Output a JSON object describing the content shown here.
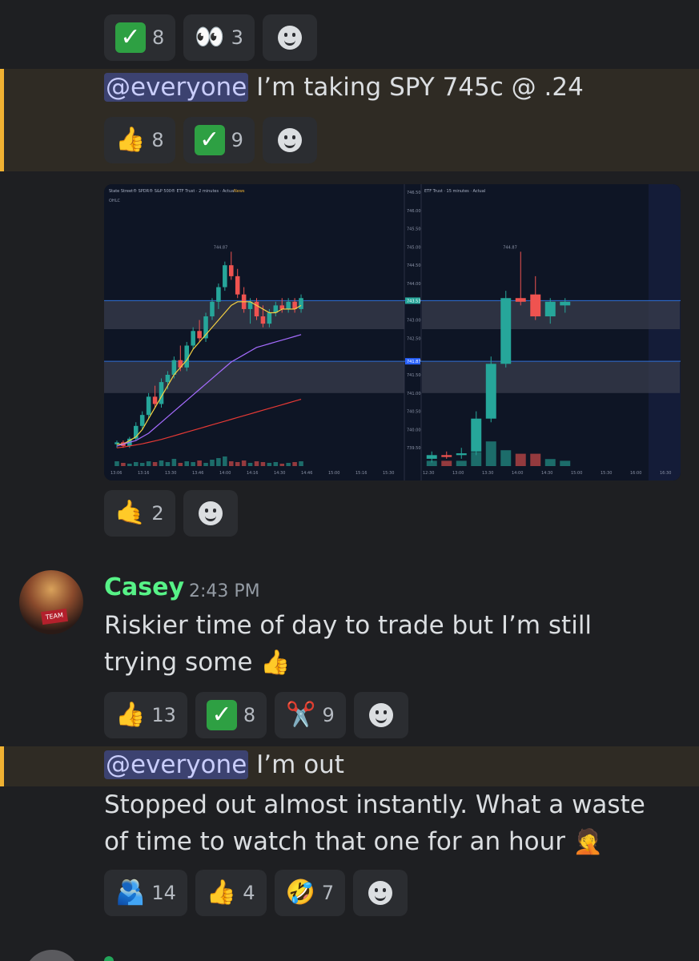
{
  "messages": {
    "top_reactions": [
      {
        "emoji": "check-mark",
        "count": "8"
      },
      {
        "emoji": "eyes",
        "count": "3"
      }
    ],
    "entry_message": {
      "mention": "@everyone",
      "text": "I’m taking SPY 745c @ .24",
      "reactions": [
        {
          "emoji": "👍",
          "count": "8"
        },
        {
          "emoji": "check-mark",
          "count": "9"
        }
      ]
    },
    "chart_reactions": [
      {
        "emoji": "🤙",
        "count": "2"
      }
    ],
    "casey_post": {
      "username": "Casey",
      "timestamp": "2:43 PM",
      "text": "Riskier time of day to trade but I’m still trying some",
      "reactions": [
        {
          "emoji": "👍",
          "count": "13"
        },
        {
          "emoji": "check-mark",
          "count": "8"
        },
        {
          "emoji": "✂️",
          "count": "9"
        }
      ]
    },
    "exit_message": {
      "mention": "@everyone",
      "text": "I’m out",
      "followup": "Stopped out almost instantly. What a waste of time to watch that one for an hour",
      "reactions": [
        {
          "emoji": "🫂",
          "count": "14"
        },
        {
          "emoji": "👍",
          "count": "4"
        },
        {
          "emoji": "🤣",
          "count": "7"
        }
      ]
    }
  },
  "chart_data": [
    {
      "type": "candlestick",
      "title": "State Street® SPDR® S&P 500® ETF Trust · 2 minutes · Actual",
      "news_label": "News",
      "indicator_label": "OHLC",
      "ylim": [
        739.0,
        746.5
      ],
      "y_ticks": [
        "746.50",
        "746.00",
        "745.50",
        "745.00",
        "744.50",
        "744.00",
        "743.53",
        "743.00",
        "742.50",
        "741.87",
        "741.50",
        "741.00",
        "740.50",
        "740.00",
        "739.50"
      ],
      "x_ticks": [
        "13:06",
        "13:16",
        "13:30",
        "13:46",
        "14:00",
        "14:16",
        "14:30",
        "14:46",
        "15:00",
        "15:16",
        "15:30"
      ],
      "high_label": "744.87",
      "price_lines": [
        743.53,
        741.87
      ],
      "price_line_colors": [
        "#26a69a",
        "#2962ff"
      ],
      "candles": [
        [
          739.6,
          739.7,
          739.5,
          739.65
        ],
        [
          739.65,
          739.7,
          739.5,
          739.55
        ],
        [
          739.55,
          739.8,
          739.5,
          739.75
        ],
        [
          739.75,
          740.2,
          739.7,
          740.1
        ],
        [
          740.1,
          740.5,
          740.0,
          740.4
        ],
        [
          740.4,
          741.0,
          740.3,
          740.9
        ],
        [
          740.9,
          741.2,
          740.6,
          740.7
        ],
        [
          740.7,
          741.4,
          740.6,
          741.3
        ],
        [
          741.3,
          741.6,
          741.1,
          741.5
        ],
        [
          741.5,
          742.0,
          741.4,
          741.9
        ],
        [
          741.9,
          742.3,
          741.6,
          741.7
        ],
        [
          741.7,
          742.4,
          741.6,
          742.3
        ],
        [
          742.3,
          742.8,
          742.2,
          742.7
        ],
        [
          742.7,
          743.0,
          742.4,
          742.5
        ],
        [
          742.5,
          743.2,
          742.4,
          743.1
        ],
        [
          743.1,
          743.6,
          743.0,
          743.5
        ],
        [
          743.5,
          744.0,
          743.3,
          743.9
        ],
        [
          743.9,
          744.6,
          743.8,
          744.5
        ],
        [
          744.5,
          744.87,
          744.1,
          744.2
        ],
        [
          744.2,
          744.4,
          743.6,
          743.7
        ],
        [
          743.7,
          743.9,
          743.2,
          743.3
        ],
        [
          743.3,
          743.6,
          742.9,
          743.5
        ],
        [
          743.5,
          743.6,
          743.0,
          743.1
        ],
        [
          743.1,
          743.4,
          742.8,
          742.9
        ],
        [
          742.9,
          743.3,
          742.8,
          743.2
        ],
        [
          743.2,
          743.5,
          743.1,
          743.4
        ],
        [
          743.4,
          743.6,
          743.2,
          743.3
        ],
        [
          743.3,
          743.6,
          743.2,
          743.5
        ],
        [
          743.5,
          743.6,
          743.2,
          743.3
        ],
        [
          743.3,
          743.7,
          743.2,
          743.6
        ]
      ],
      "ema_fast": [
        739.6,
        739.6,
        739.7,
        739.8,
        740.0,
        740.3,
        740.6,
        740.9,
        741.2,
        741.5,
        741.7,
        741.9,
        742.2,
        742.4,
        742.6,
        742.8,
        743.0,
        743.2,
        743.4,
        743.5,
        743.5,
        743.5,
        743.4,
        743.3,
        743.2,
        743.2,
        743.3,
        743.3,
        743.3,
        743.4
      ],
      "ema_mid": [
        739.55,
        739.6,
        739.65,
        739.7,
        739.8,
        739.9,
        740.05,
        740.2,
        740.35,
        740.5,
        740.65,
        740.8,
        740.95,
        741.1,
        741.25,
        741.4,
        741.55,
        741.7,
        741.85,
        741.95,
        742.05,
        742.15,
        742.25,
        742.3,
        742.35,
        742.4,
        742.45,
        742.5,
        742.55,
        742.6
      ],
      "ema_slow": [
        739.5,
        739.52,
        739.55,
        739.58,
        739.61,
        739.65,
        739.69,
        739.73,
        739.78,
        739.83,
        739.88,
        739.93,
        739.98,
        740.03,
        740.08,
        740.13,
        740.18,
        740.23,
        740.28,
        740.33,
        740.38,
        740.43,
        740.48,
        740.53,
        740.58,
        740.63,
        740.68,
        740.73,
        740.78,
        740.83
      ],
      "volume": [
        6,
        4,
        3,
        5,
        4,
        6,
        5,
        7,
        5,
        9,
        4,
        6,
        5,
        7,
        4,
        8,
        10,
        12,
        6,
        5,
        7,
        4,
        6,
        5,
        4,
        5,
        3,
        4,
        5,
        6
      ]
    },
    {
      "type": "candlestick",
      "title": "ETF Trust · 15 minutes · Actual",
      "ylim": [
        739.0,
        746.5
      ],
      "x_ticks": [
        "12:30",
        "13:00",
        "13:30",
        "14:00",
        "14:30",
        "15:00",
        "15:30",
        "16:00",
        "16:30"
      ],
      "high_label": "744.87",
      "candles": [
        [
          739.2,
          739.4,
          739.1,
          739.3
        ],
        [
          739.3,
          739.4,
          739.2,
          739.25
        ],
        [
          739.3,
          739.5,
          739.2,
          739.35
        ],
        [
          739.4,
          740.5,
          739.3,
          740.3
        ],
        [
          740.3,
          742.0,
          740.2,
          741.8
        ],
        [
          741.8,
          743.8,
          741.7,
          743.6
        ],
        [
          743.6,
          744.87,
          743.4,
          743.5
        ],
        [
          743.7,
          744.2,
          743.0,
          743.1
        ],
        [
          743.1,
          743.6,
          742.9,
          743.5
        ],
        [
          743.4,
          743.6,
          743.2,
          743.5
        ]
      ],
      "volume": [
        3,
        3,
        3,
        8,
        14,
        9,
        7,
        7,
        4,
        3
      ]
    }
  ],
  "colors": {
    "mention_bg": "#3c4270",
    "highlight_border": "#f0b232",
    "username": "#57f287",
    "bull": "#26a69a",
    "bear": "#ef5350"
  }
}
